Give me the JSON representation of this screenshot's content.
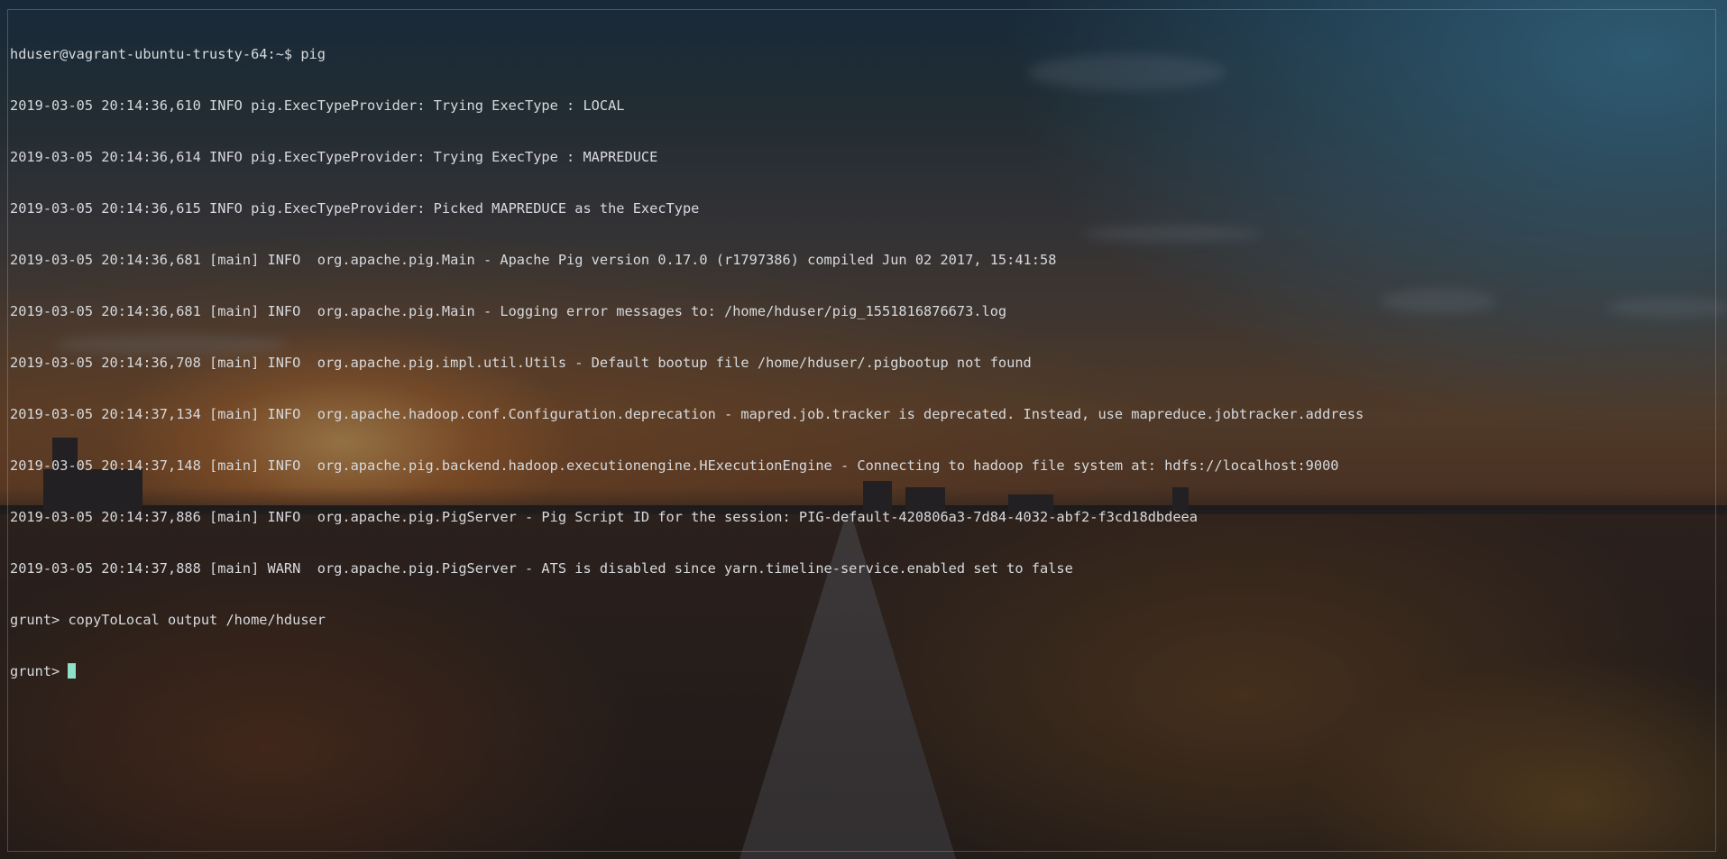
{
  "terminal": {
    "lines": [
      "hduser@vagrant-ubuntu-trusty-64:~$ pig",
      "2019-03-05 20:14:36,610 INFO pig.ExecTypeProvider: Trying ExecType : LOCAL",
      "2019-03-05 20:14:36,614 INFO pig.ExecTypeProvider: Trying ExecType : MAPREDUCE",
      "2019-03-05 20:14:36,615 INFO pig.ExecTypeProvider: Picked MAPREDUCE as the ExecType",
      "2019-03-05 20:14:36,681 [main] INFO  org.apache.pig.Main - Apache Pig version 0.17.0 (r1797386) compiled Jun 02 2017, 15:41:58",
      "2019-03-05 20:14:36,681 [main] INFO  org.apache.pig.Main - Logging error messages to: /home/hduser/pig_1551816876673.log",
      "2019-03-05 20:14:36,708 [main] INFO  org.apache.pig.impl.util.Utils - Default bootup file /home/hduser/.pigbootup not found",
      "2019-03-05 20:14:37,134 [main] INFO  org.apache.hadoop.conf.Configuration.deprecation - mapred.job.tracker is deprecated. Instead, use mapreduce.jobtracker.address",
      "2019-03-05 20:14:37,148 [main] INFO  org.apache.pig.backend.hadoop.executionengine.HExecutionEngine - Connecting to hadoop file system at: hdfs://localhost:9000",
      "2019-03-05 20:14:37,886 [main] INFO  org.apache.pig.PigServer - Pig Script ID for the session: PIG-default-420806a3-7d84-4032-abf2-f3cd18dbdeea",
      "2019-03-05 20:14:37,888 [main] WARN  org.apache.pig.PigServer - ATS is disabled since yarn.timeline-service.enabled set to false",
      "grunt> copyToLocal output /home/hduser"
    ],
    "prompt": "grunt> ",
    "text_color": "#d7dade",
    "cursor_color": "#8fe0c8"
  }
}
